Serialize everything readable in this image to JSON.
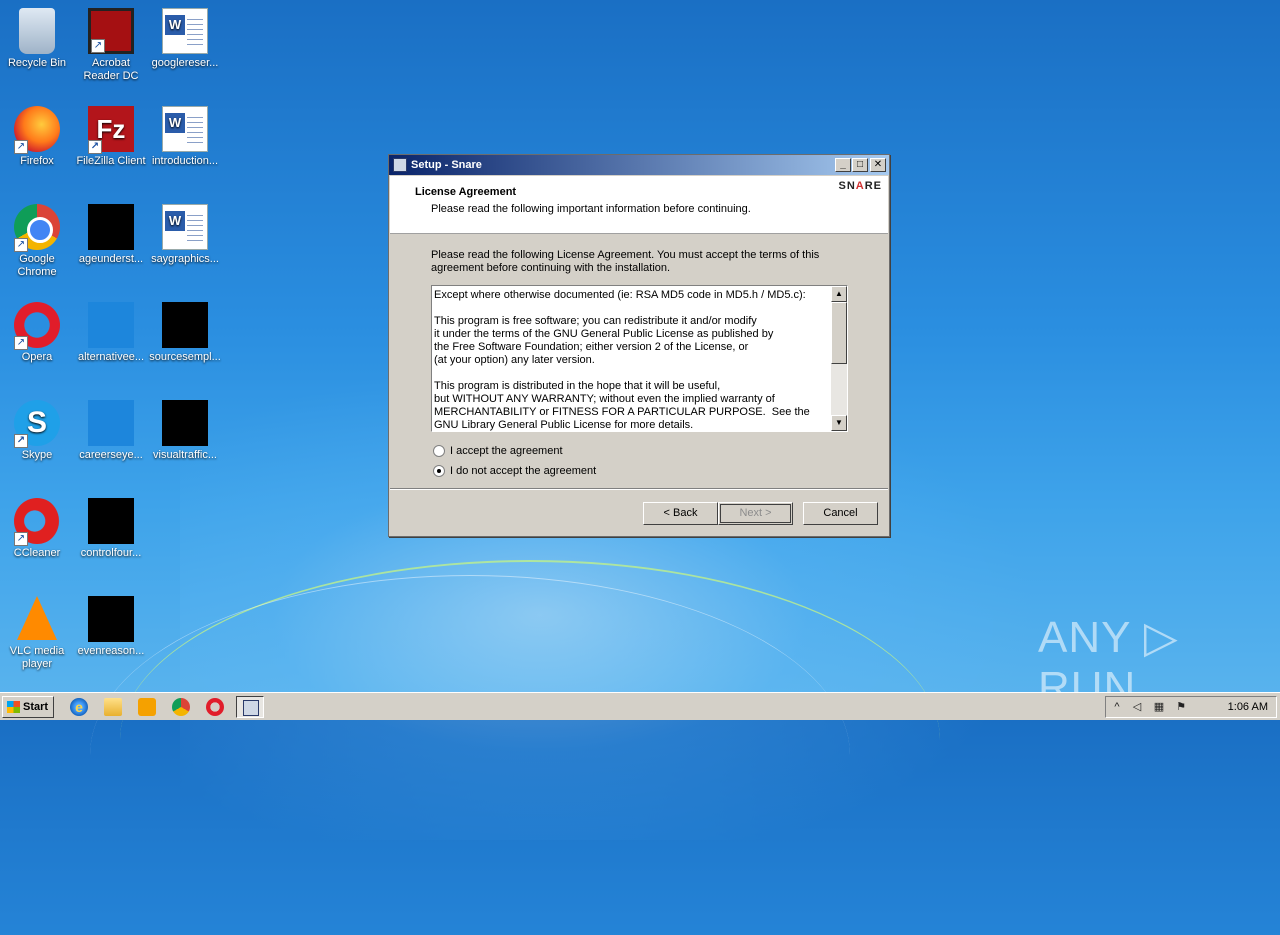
{
  "desktop": {
    "icons": [
      {
        "label": "Recycle Bin"
      },
      {
        "label": "Acrobat\nReader DC"
      },
      {
        "label": "googlereser..."
      },
      {
        "label": "Firefox"
      },
      {
        "label": "FileZilla Client"
      },
      {
        "label": "introduction..."
      },
      {
        "label": "Google\nChrome"
      },
      {
        "label": "ageunderst..."
      },
      {
        "label": "saygraphics..."
      },
      {
        "label": "Opera"
      },
      {
        "label": "alternativee..."
      },
      {
        "label": "sourcesempl..."
      },
      {
        "label": "Skype"
      },
      {
        "label": "careerseye..."
      },
      {
        "label": "visualtraffic..."
      },
      {
        "label": "CCleaner"
      },
      {
        "label": "controlfour..."
      },
      {
        "label": "VLC media\nplayer"
      },
      {
        "label": "evenreason..."
      }
    ]
  },
  "dialog": {
    "title": "Setup - Snare",
    "header_title": "License Agreement",
    "header_subtitle": "Please read the following important information before continuing.",
    "logo_text_prefix": "SN",
    "logo_text_accent": "A",
    "logo_text_suffix": "RE",
    "intro": "Please read the following License Agreement. You must accept the terms of this agreement before continuing with the installation.",
    "license_text": "Except where otherwise documented (ie: RSA MD5 code in MD5.h / MD5.c):\n\nThis program is free software; you can redistribute it and/or modify\nit under the terms of the GNU General Public License as published by\nthe Free Software Foundation; either version 2 of the License, or\n(at your option) any later version.\n\nThis program is distributed in the hope that it will be useful,\nbut WITHOUT ANY WARRANTY; without even the implied warranty of\nMERCHANTABILITY or FITNESS FOR A PARTICULAR PURPOSE.  See the\nGNU Library General Public License for more details.",
    "radio_accept": "I accept the agreement",
    "radio_decline": "I do not accept the agreement",
    "selected_option": "decline",
    "back_label": "< Back",
    "next_label": "Next >",
    "cancel_label": "Cancel",
    "minimize_glyph": "_",
    "maximize_glyph": "□",
    "close_glyph": "✕",
    "scroll_up_glyph": "▲",
    "scroll_down_glyph": "▼"
  },
  "taskbar": {
    "start_label": "Start",
    "clock": "1:06 AM",
    "tray_expand_glyph": "^"
  },
  "watermark": "ANY ▷ RUN"
}
